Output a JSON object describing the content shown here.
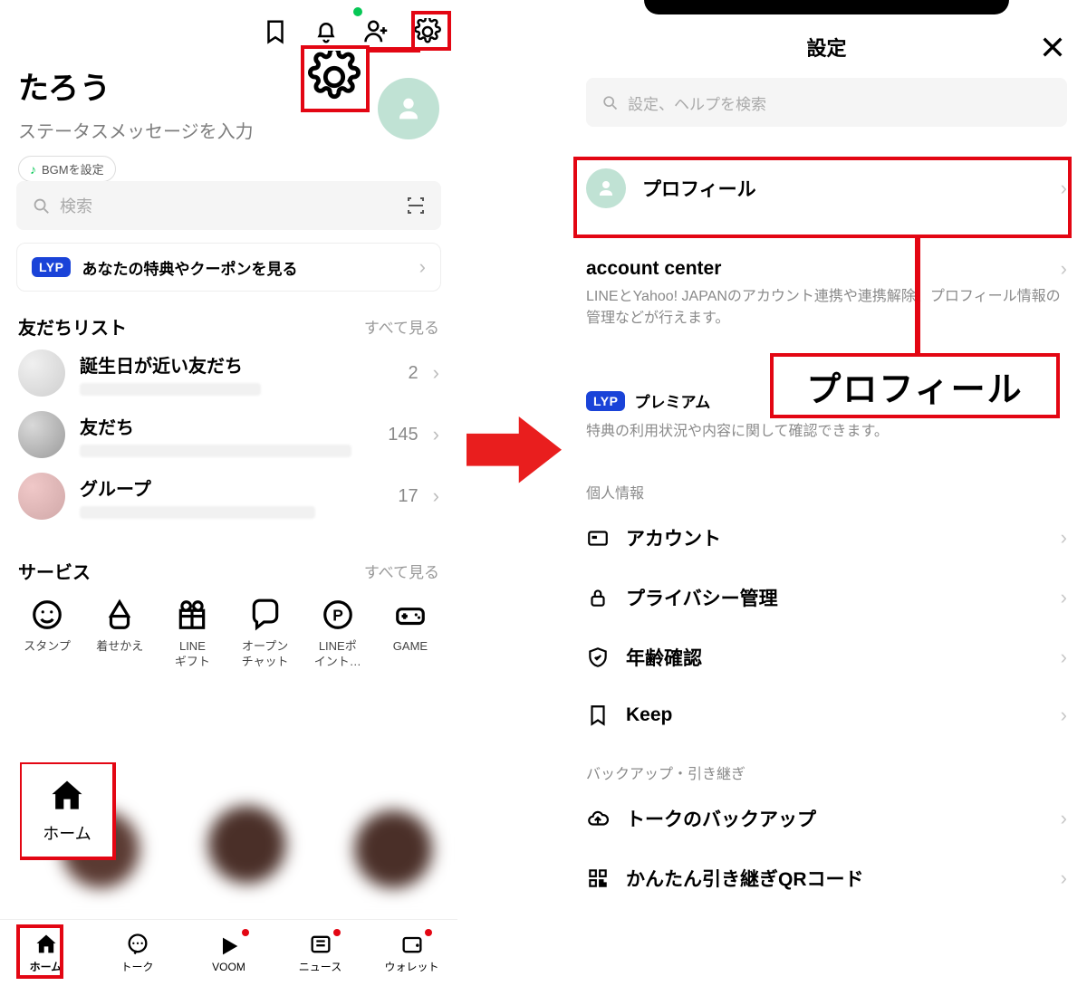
{
  "left": {
    "username": "たろう",
    "status": "ステータスメッセージを入力",
    "bgm": "BGMを設定",
    "search_placeholder": "検索",
    "lyp_text": "あなたの特典やクーポンを見る",
    "friends_title": "友だちリスト",
    "see_all": "すべて見る",
    "rows": [
      {
        "name": "誕生日が近い友だち",
        "count": "2"
      },
      {
        "name": "友だち",
        "count": "145"
      },
      {
        "name": "グループ",
        "count": "17"
      }
    ],
    "services_title": "サービス",
    "services": [
      {
        "label": "スタンプ"
      },
      {
        "label": "着せかえ"
      },
      {
        "label": "LINE\nギフト"
      },
      {
        "label": "オープン\nチャット"
      },
      {
        "label": "LINEポ\nイント…"
      },
      {
        "label": "GAME"
      }
    ],
    "home_callout": "ホーム",
    "tabs": [
      {
        "label": "ホーム"
      },
      {
        "label": "トーク"
      },
      {
        "label": "VOOM"
      },
      {
        "label": "ニュース"
      },
      {
        "label": "ウォレット"
      }
    ]
  },
  "right": {
    "title": "設定",
    "search_placeholder": "設定、ヘルプを検索",
    "profile": "プロフィール",
    "account_center_title": "account center",
    "account_center_desc": "LINEとYahoo! JAPANのアカウント連携や連携解除、プロフィール情報の管理などが行えます。",
    "lyp_premium": "プレミアム",
    "lyp_desc": "特典の利用状況や内容に関して確認できます。",
    "section_personal": "個人情報",
    "items_personal": [
      {
        "label": "アカウント"
      },
      {
        "label": "プライバシー管理"
      },
      {
        "label": "年齢確認"
      },
      {
        "label": "Keep"
      }
    ],
    "section_backup": "バックアップ・引き継ぎ",
    "items_backup": [
      {
        "label": "トークのバックアップ"
      },
      {
        "label": "かんたん引き継ぎQRコード"
      }
    ],
    "callout": "プロフィール"
  },
  "lyp_badge": "LYP"
}
